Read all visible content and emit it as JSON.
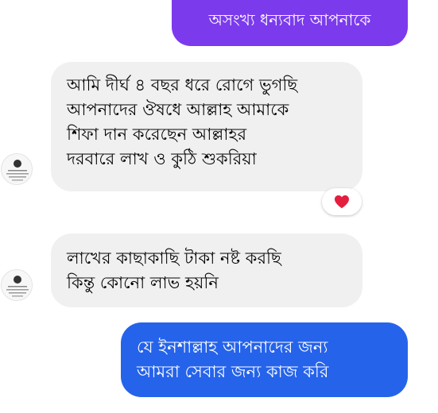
{
  "conversation": {
    "messages": [
      {
        "sender": "self",
        "lines": [
          "অসংখ্য ধন্যবাদ আপনাকে"
        ]
      },
      {
        "sender": "other",
        "lines": [
          "আমি দীর্ঘ ৪ বছর ধরে রোগে ভুগছি",
          "আপনাদের ঔষধে আল্লাহ আমাকে",
          "শিফা দান করেছেন আল্লাহর",
          "দরবারে লাখ ও কুঠি শুকরিয়া"
        ],
        "reaction": "heart-icon"
      },
      {
        "sender": "other",
        "lines": [
          "লাখের কাছাকাছি টাকা নষ্ট করছি",
          "কিন্তু কোনো লাভ হয়নি"
        ]
      },
      {
        "sender": "self",
        "lines": [
          "যে ইনশাল্লাহ আপনাদের জন্য",
          "আমরা সেবার জন্য কাজ করি"
        ]
      }
    ]
  },
  "colors": {
    "outgoing_top": "#7c3aed",
    "outgoing_bottom": "#2563eb",
    "incoming": "#f0f0f0",
    "reaction_heart": "#e41e3f"
  }
}
